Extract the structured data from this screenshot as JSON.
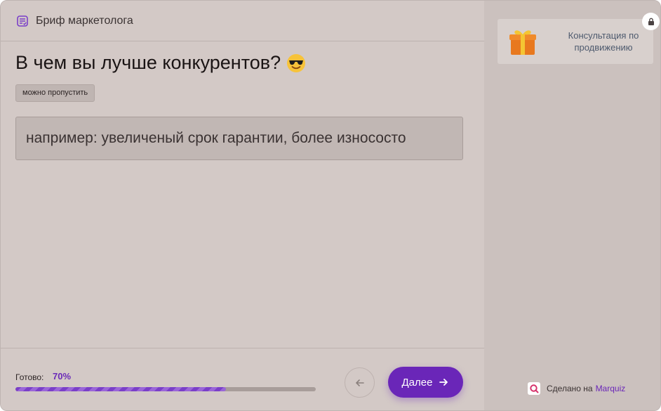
{
  "header": {
    "icon": "brief-list-icon",
    "title": "Бриф маркетолога"
  },
  "question": {
    "text": "В чем вы лучше конкурентов?",
    "emoji": "smiling-face-with-sunglasses-icon",
    "skip_badge": "можно пропустить"
  },
  "answer": {
    "value": "",
    "placeholder": "например: увеличеный срок гарантии, более износосто"
  },
  "footer": {
    "progress_label": "Готово:",
    "progress_text": "70%",
    "progress_fraction": 0.7,
    "back_icon": "arrow-left-icon",
    "next_label": "Далее",
    "next_icon": "arrow-right-icon"
  },
  "sidebar": {
    "bonus": {
      "icon": "gift-icon",
      "text": "Консультация по продвижению",
      "lock_icon": "lock-icon"
    },
    "made_with_prefix": "Сделано на",
    "made_with_brand": "Marquiz"
  },
  "colors": {
    "accent": "#6a26b8",
    "background": "#d3c9c6",
    "sidebar_background": "#cbc1be"
  }
}
